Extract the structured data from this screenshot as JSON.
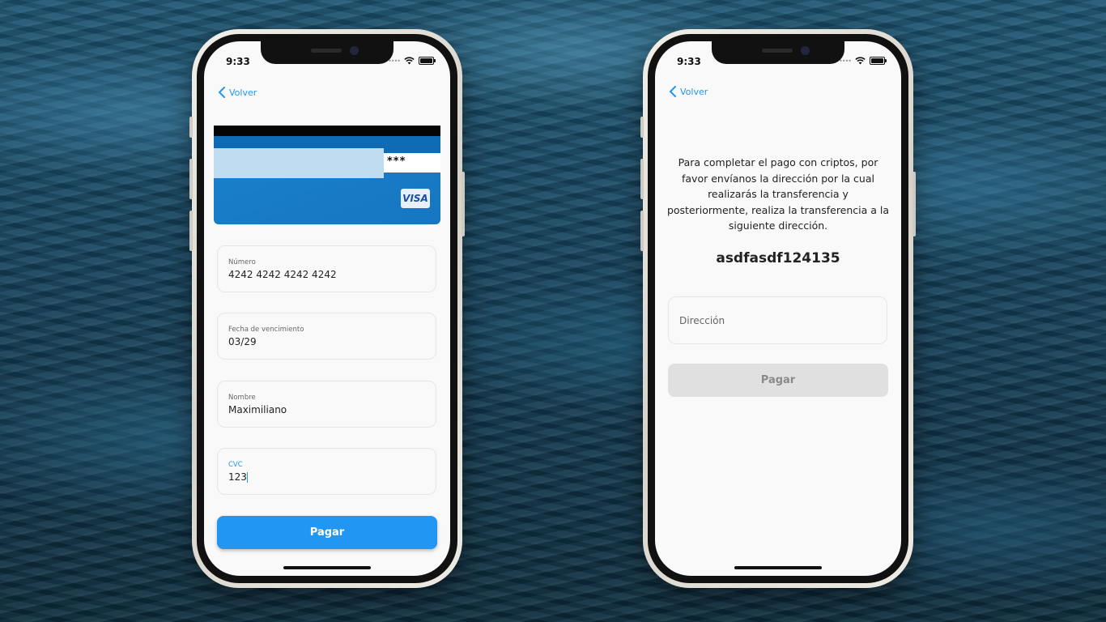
{
  "phones": {
    "card": {
      "time": "9:33",
      "back_label": "Volver",
      "card_visual": {
        "cvc_mask": "***",
        "brand": "VISA"
      },
      "fields": [
        {
          "label": "Número",
          "value": "4242 4242 4242 4242"
        },
        {
          "label": "Fecha de vencimiento",
          "value": "03/29"
        },
        {
          "label": "Nombre",
          "value": "Maximiliano"
        },
        {
          "label": "CVC",
          "value": "123"
        }
      ],
      "pay_label": "Pagar"
    },
    "crypto": {
      "time": "9:33",
      "back_label": "Volver",
      "description": "Para completar el pago con criptos, por favor envíanos la dirección por la cual realizarás la transferencia y posteriormente, realiza la transferencia a la siguiente dirección.",
      "address": "asdfasdf124135",
      "address_field_placeholder": "Dirección",
      "pay_label": "Pagar"
    }
  },
  "colors": {
    "accent": "#2196f3",
    "card_blue": "#1b82cc",
    "disabled_button": "#e0e0e0"
  }
}
